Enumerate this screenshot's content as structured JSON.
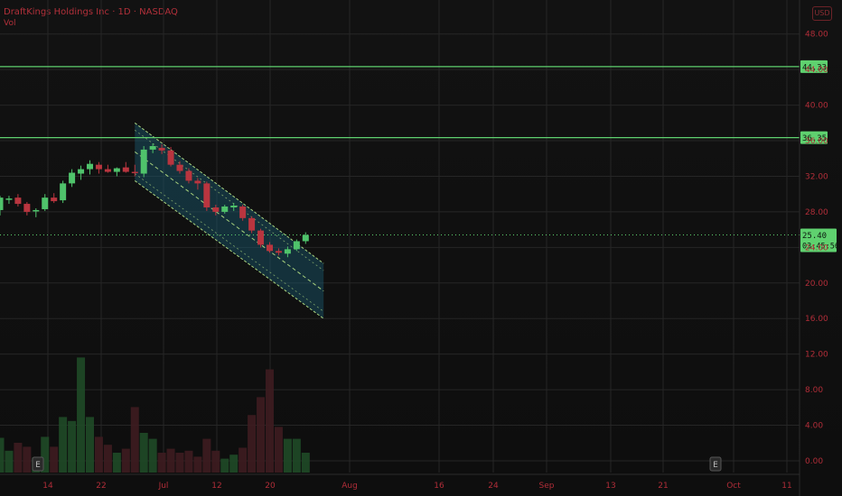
{
  "header": {
    "title": "DraftKings Holdings Inc · 1D · NASDAQ",
    "subtitle": "Vol"
  },
  "corner_label": "USD",
  "colors": {
    "up": "#4fc36b",
    "down": "#b9353f",
    "level": "#5fd16f",
    "channel_fill": "#1b5a72",
    "channel_line": "#a9d37e",
    "axis_text": "#b02d38",
    "grid": "#262626"
  },
  "price_tag": {
    "price": "25.40",
    "countdown": "03:45:56"
  },
  "chart_data": {
    "type": "candlestick",
    "title": "DraftKings Holdings Inc · 1D · NASDAQ",
    "y_ticks": [
      "48.00",
      "44.00",
      "40.00",
      "36.00",
      "32.00",
      "28.00",
      "24.00",
      "20.00",
      "16.00",
      "12.00",
      "8.00",
      "4.00",
      "0.00"
    ],
    "ylim": [
      0,
      48
    ],
    "x_ticks": [
      "14",
      "22",
      "Jul",
      "12",
      "20",
      "Aug",
      "16",
      "24",
      "Sep",
      "13",
      "21",
      "Oct",
      "11"
    ],
    "grid": true,
    "levels": [
      {
        "price": 44.33,
        "label": "44.33"
      },
      {
        "price": 36.35,
        "label": "36.35"
      }
    ],
    "current_price": 25.4,
    "earnings_markers": [
      "E",
      "E"
    ],
    "channel": {
      "start_index": 15,
      "end_index": 36,
      "upper_start": 38.0,
      "upper_end": 22.2,
      "lower_start": 31.5,
      "lower_end": 16.0
    },
    "candles": [
      {
        "o": 28.2,
        "h": 29.8,
        "l": 27.6,
        "c": 29.6,
        "v": 3.5
      },
      {
        "o": 29.4,
        "h": 29.8,
        "l": 28.9,
        "c": 29.5,
        "v": 2.2
      },
      {
        "o": 29.6,
        "h": 30.0,
        "l": 28.6,
        "c": 28.9,
        "v": 3.0
      },
      {
        "o": 28.9,
        "h": 29.1,
        "l": 27.6,
        "c": 28.0,
        "v": 2.6
      },
      {
        "o": 28.1,
        "h": 28.4,
        "l": 27.4,
        "c": 28.2,
        "v": 1.5
      },
      {
        "o": 28.3,
        "h": 30.0,
        "l": 28.1,
        "c": 29.6,
        "v": 3.6
      },
      {
        "o": 29.6,
        "h": 30.1,
        "l": 29.0,
        "c": 29.2,
        "v": 2.6
      },
      {
        "o": 29.3,
        "h": 31.5,
        "l": 29.0,
        "c": 31.2,
        "v": 5.6
      },
      {
        "o": 31.2,
        "h": 32.8,
        "l": 30.8,
        "c": 32.4,
        "v": 5.2
      },
      {
        "o": 32.3,
        "h": 33.2,
        "l": 31.6,
        "c": 32.8,
        "v": 11.6
      },
      {
        "o": 32.8,
        "h": 33.8,
        "l": 32.2,
        "c": 33.4,
        "v": 5.6
      },
      {
        "o": 33.3,
        "h": 33.6,
        "l": 32.3,
        "c": 32.8,
        "v": 3.6
      },
      {
        "o": 32.8,
        "h": 33.3,
        "l": 32.4,
        "c": 32.5,
        "v": 2.8
      },
      {
        "o": 32.5,
        "h": 33.0,
        "l": 32.0,
        "c": 32.9,
        "v": 2.0
      },
      {
        "o": 33.0,
        "h": 33.6,
        "l": 32.4,
        "c": 32.5,
        "v": 2.4
      },
      {
        "o": 32.5,
        "h": 33.3,
        "l": 32.0,
        "c": 32.4,
        "v": 6.6
      },
      {
        "o": 32.3,
        "h": 35.4,
        "l": 31.9,
        "c": 35.0,
        "v": 4.0
      },
      {
        "o": 35.0,
        "h": 35.7,
        "l": 34.6,
        "c": 35.4,
        "v": 3.4
      },
      {
        "o": 35.2,
        "h": 35.6,
        "l": 34.5,
        "c": 34.9,
        "v": 2.0
      },
      {
        "o": 34.9,
        "h": 35.3,
        "l": 33.1,
        "c": 33.3,
        "v": 2.4
      },
      {
        "o": 33.3,
        "h": 33.7,
        "l": 32.3,
        "c": 32.6,
        "v": 2.0
      },
      {
        "o": 32.6,
        "h": 32.9,
        "l": 31.2,
        "c": 31.5,
        "v": 2.2
      },
      {
        "o": 31.5,
        "h": 31.8,
        "l": 30.5,
        "c": 31.2,
        "v": 1.6
      },
      {
        "o": 31.2,
        "h": 31.4,
        "l": 28.1,
        "c": 28.5,
        "v": 3.4
      },
      {
        "o": 28.5,
        "h": 28.8,
        "l": 27.6,
        "c": 28.0,
        "v": 2.2
      },
      {
        "o": 28.0,
        "h": 28.8,
        "l": 27.8,
        "c": 28.6,
        "v": 1.4
      },
      {
        "o": 28.5,
        "h": 29.0,
        "l": 28.1,
        "c": 28.7,
        "v": 1.8
      },
      {
        "o": 28.6,
        "h": 28.8,
        "l": 27.0,
        "c": 27.3,
        "v": 2.5
      },
      {
        "o": 27.3,
        "h": 27.5,
        "l": 25.6,
        "c": 25.9,
        "v": 5.8
      },
      {
        "o": 25.9,
        "h": 26.1,
        "l": 24.0,
        "c": 24.3,
        "v": 7.6
      },
      {
        "o": 24.3,
        "h": 24.6,
        "l": 23.4,
        "c": 23.6,
        "v": 10.4
      },
      {
        "o": 23.6,
        "h": 23.9,
        "l": 23.1,
        "c": 23.4,
        "v": 4.6
      },
      {
        "o": 23.3,
        "h": 24.1,
        "l": 22.9,
        "c": 23.8,
        "v": 3.4
      },
      {
        "o": 23.8,
        "h": 24.9,
        "l": 23.6,
        "c": 24.7,
        "v": 3.4
      },
      {
        "o": 24.7,
        "h": 25.7,
        "l": 24.4,
        "c": 25.4,
        "v": 2.0
      }
    ]
  }
}
